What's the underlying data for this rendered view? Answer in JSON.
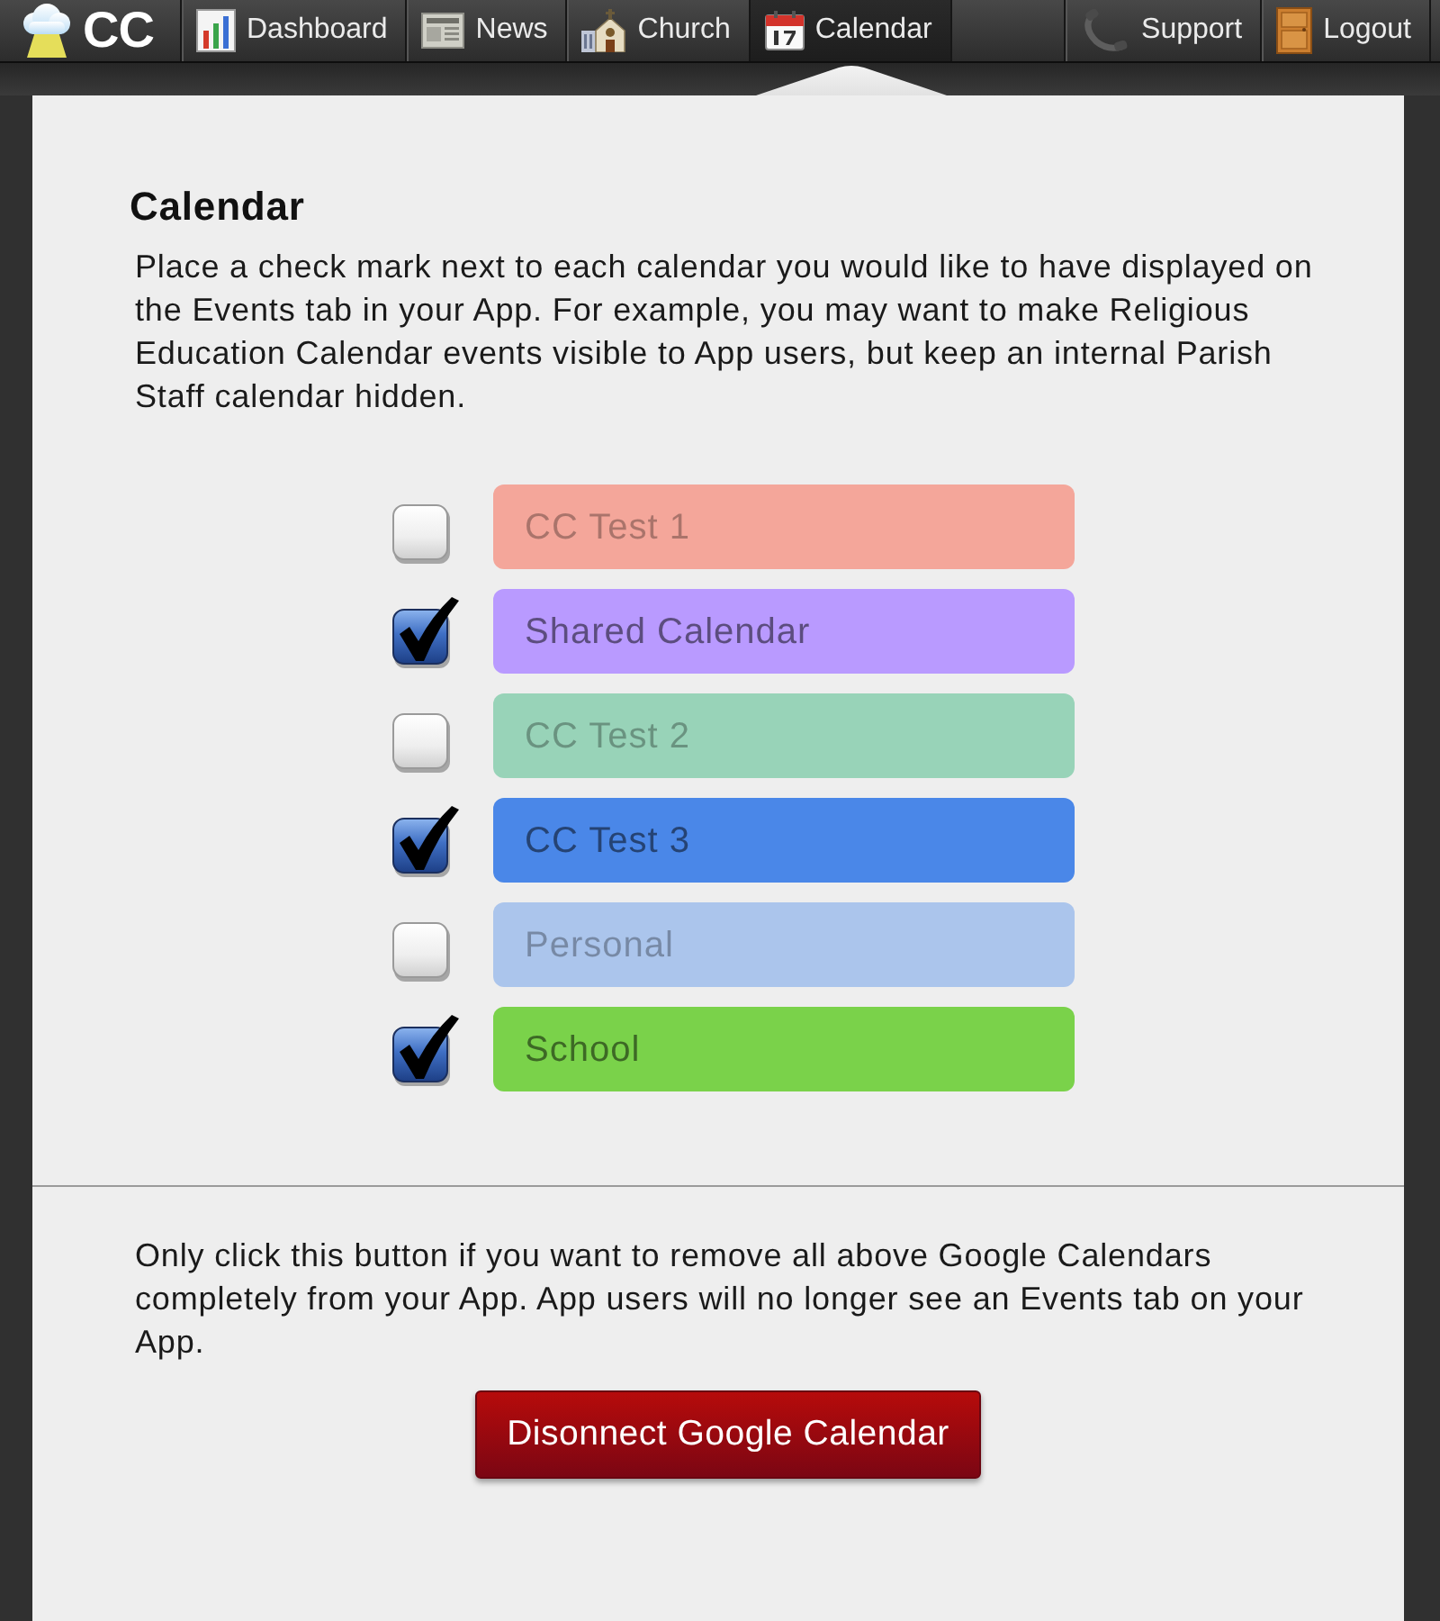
{
  "brand": {
    "text": "CC"
  },
  "nav": [
    {
      "label": "Dashboard",
      "selected": false
    },
    {
      "label": "News",
      "selected": false
    },
    {
      "label": "Church",
      "selected": false
    },
    {
      "label": "Calendar",
      "selected": true
    }
  ],
  "nav_right": [
    {
      "label": "Support"
    },
    {
      "label": "Logout"
    }
  ],
  "section": {
    "title": "Calendar",
    "description": "Place a check mark next to each calendar you would like to have displayed on the Events tab in your App. For example, you may want to make Religious Education Calendar events visible to App users, but keep an internal Parish Staff calendar hidden."
  },
  "calendars": [
    {
      "name": "CC Test 1",
      "checked": false,
      "color": "#f4a69a"
    },
    {
      "name": "Shared Calendar",
      "checked": true,
      "color": "#b99aff"
    },
    {
      "name": "CC Test 2",
      "checked": false,
      "color": "#98d3b8"
    },
    {
      "name": "CC Test 3",
      "checked": true,
      "color": "#4a87e8"
    },
    {
      "name": "Personal",
      "checked": false,
      "color": "#abc5ec"
    },
    {
      "name": "School",
      "checked": true,
      "color": "#7ad24a"
    }
  ],
  "disconnect": {
    "note": "Only click this button if you want to remove all above Google Calendars completely from your App. App users will no longer see an Events tab on your App.",
    "button": "Disonnect Google Calendar"
  }
}
